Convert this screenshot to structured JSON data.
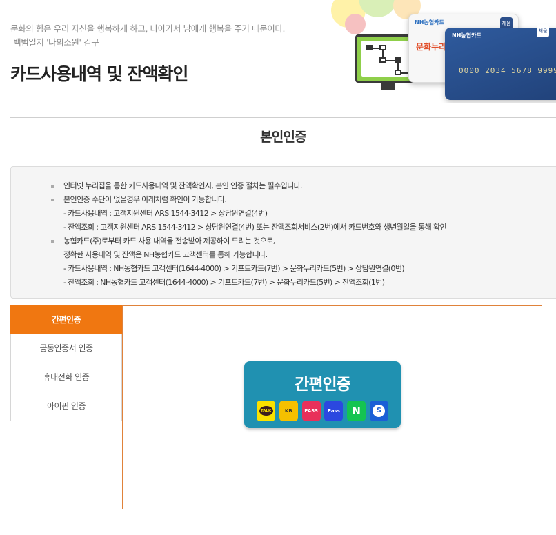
{
  "header": {
    "quote_line1": "문화의 힘은 우리 자신을 행복하게 하고, 나아가서 남에게 행복을 주기 때문이다.",
    "quote_line2": "-백범일지 '나의소원' 김구 -",
    "page_title": "카드사용내역 및 잔액확인",
    "card_brand_white": "NH농협카드",
    "card_brand_blue": "NH농협카드",
    "card_brand_white_text": "문화누리",
    "card_number": "0000 2034 5678 9999",
    "card_badge": "체움"
  },
  "section": {
    "title": "본인인증"
  },
  "notice": {
    "items": [
      {
        "text": "인터넷 누리집을 통한 카드사용내역 및 잔액확인시, 본인 인증 절차는 필수입니다.",
        "sub": []
      },
      {
        "text": "본인인증 수단이 없을경우 아래처럼 확인이 가능합니다.",
        "sub": [
          "- 카드사용내역 : 고객지원센터 ARS 1544-3412 > 상담원연결(4번)",
          "- 잔액조회 : 고객지원센터 ARS 1544-3412 > 상담원연결(4번) 또는 잔액조회서비스(2번)에서 카드번호와 생년월일을 통해 확인"
        ]
      },
      {
        "text": "농협카드(주)로부터 카드 사용 내역을 전송받아 제공하여 드리는 것으로,",
        "sub": [
          "정확한 사용내역 및 잔액은 NH농협카드 고객센터를 통해 가능합니다.",
          "- 카드사용내역 : NH농협카드 고객센터(1644-4000) > 기프트카드(7번) > 문화누리카드(5번) > 상담원연결(0번)",
          "- 잔액조회 : NH농협카드 고객센터(1644-4000) > 기프트카드(7번) > 문화누리카드(5번) > 잔액조회(1번)"
        ]
      }
    ]
  },
  "auth": {
    "tabs": [
      {
        "label": "간편인증",
        "active": true
      },
      {
        "label": "공동인증서 인증",
        "active": false
      },
      {
        "label": "휴대전화 인증",
        "active": false
      },
      {
        "label": "아이핀 인증",
        "active": false
      }
    ],
    "simple_button_label": "간편인증",
    "providers": [
      {
        "name": "kakao-icon",
        "label": "TALK"
      },
      {
        "name": "kb-icon",
        "label": "KB"
      },
      {
        "name": "pass-red-icon",
        "label": "PASS"
      },
      {
        "name": "pass-blue-icon",
        "label": "Pass"
      },
      {
        "name": "naver-icon",
        "label": "N"
      },
      {
        "name": "shinhan-icon",
        "label": "S"
      }
    ]
  },
  "colors": {
    "accent_orange": "#f07711",
    "simple_auth_teal": "#2091b1",
    "notice_bg": "#f5f5f5"
  }
}
